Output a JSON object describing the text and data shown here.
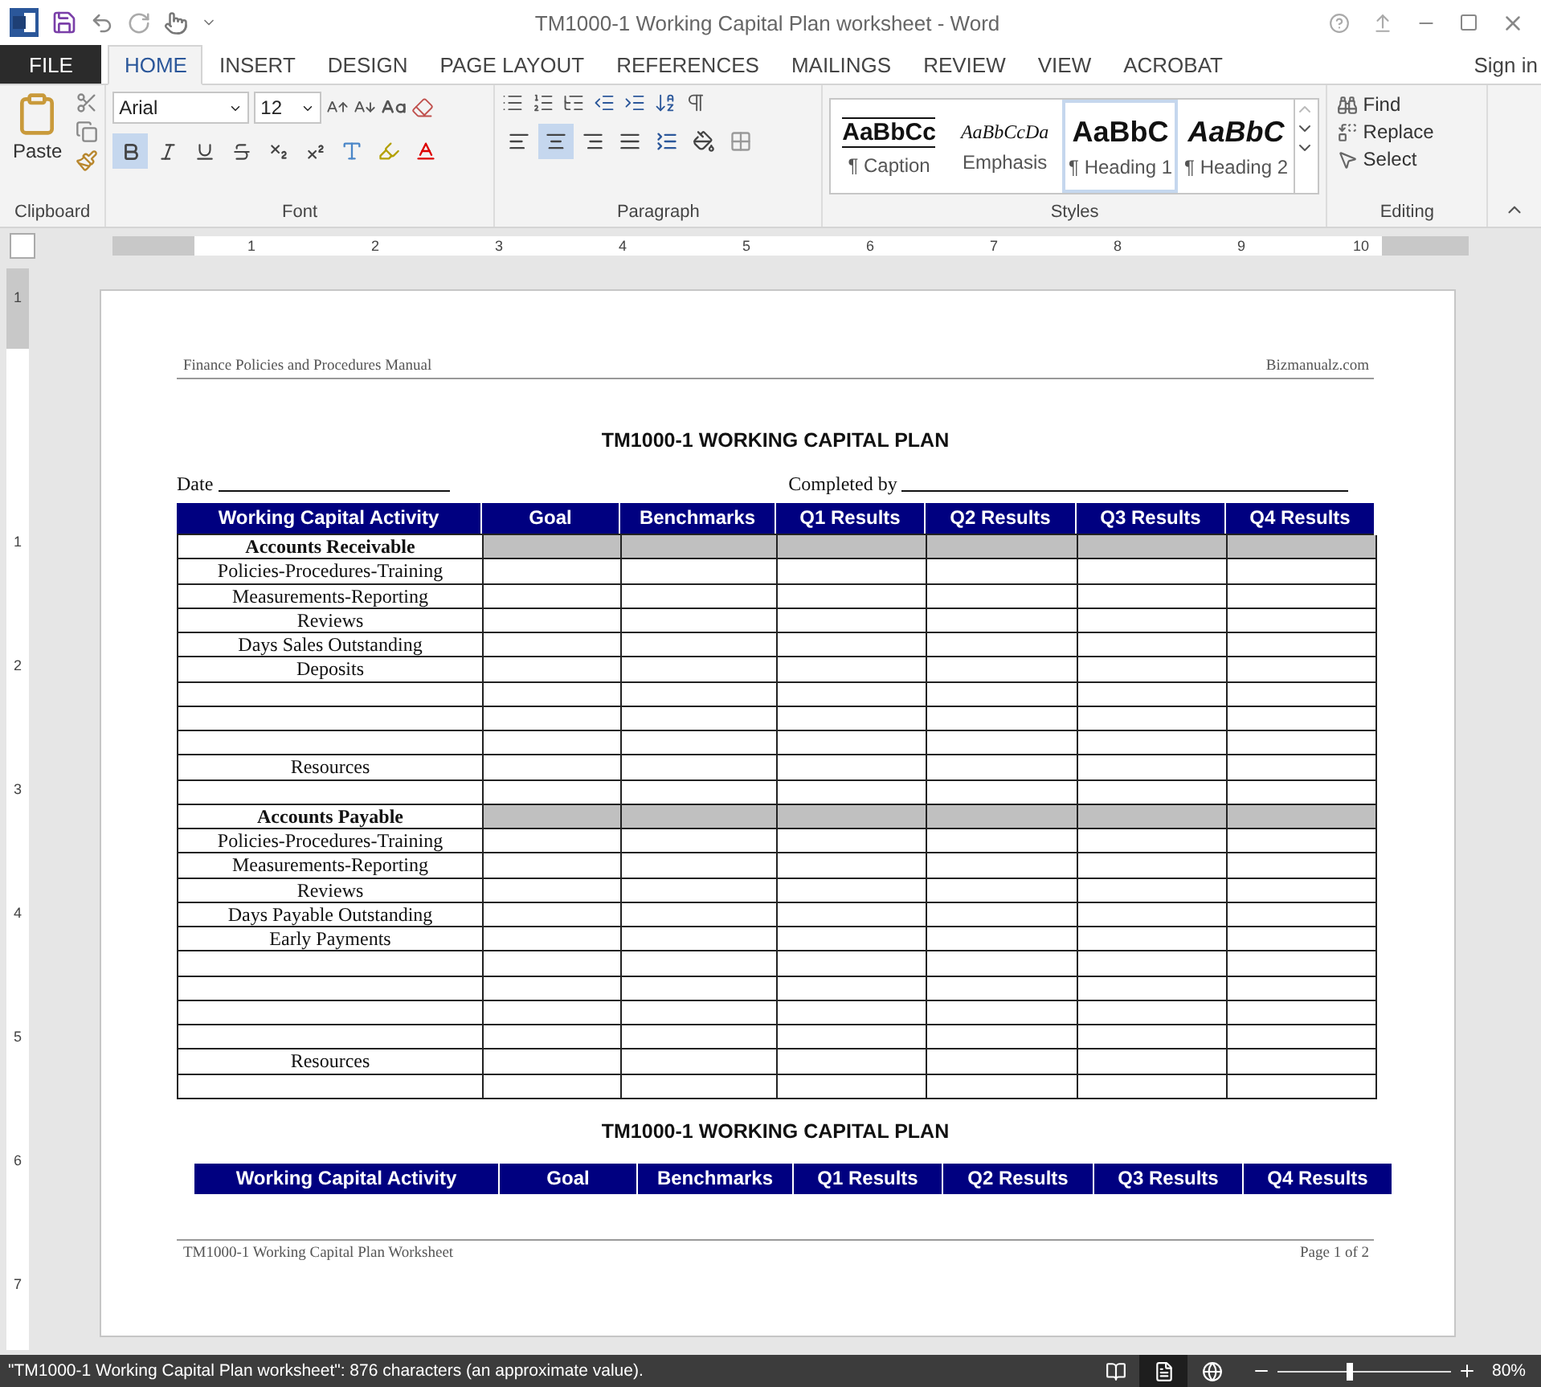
{
  "window": {
    "title": "TM1000-1 Working Capital Plan worksheet - Word"
  },
  "tabs": [
    {
      "label": "FILE",
      "kind": "file",
      "selected": false
    },
    {
      "label": "HOME",
      "kind": "tab",
      "selected": true
    },
    {
      "label": "INSERT",
      "kind": "tab",
      "selected": false
    },
    {
      "label": "DESIGN",
      "kind": "tab",
      "selected": false
    },
    {
      "label": "PAGE LAYOUT",
      "kind": "tab",
      "selected": false
    },
    {
      "label": "REFERENCES",
      "kind": "tab",
      "selected": false
    },
    {
      "label": "MAILINGS",
      "kind": "tab",
      "selected": false
    },
    {
      "label": "REVIEW",
      "kind": "tab",
      "selected": false
    },
    {
      "label": "VIEW",
      "kind": "tab",
      "selected": false
    },
    {
      "label": "ACROBAT",
      "kind": "tab",
      "selected": false
    }
  ],
  "account": {
    "label": "Sign in"
  },
  "ribbon": {
    "clipboard": {
      "label": "Clipboard",
      "paste": "Paste"
    },
    "font": {
      "label": "Font",
      "font_name": "Arial",
      "font_size": "12",
      "bold": true
    },
    "paragraph": {
      "label": "Paragraph",
      "alignments": [
        {
          "kind": "left",
          "selected": false
        },
        {
          "kind": "center",
          "selected": true
        },
        {
          "kind": "right",
          "selected": false
        },
        {
          "kind": "justify",
          "selected": false
        }
      ]
    },
    "styles": {
      "label": "Styles",
      "items": [
        {
          "preview": "AaBbCc",
          "name": "¶ Caption",
          "kind": "caption",
          "selected": false
        },
        {
          "preview": "AaBbCcDa",
          "name": "Emphasis",
          "kind": "emphasis",
          "selected": false
        },
        {
          "preview": "AaBbC",
          "name": "¶ Heading 1",
          "kind": "heading1",
          "selected": true
        },
        {
          "preview": "AaBbC",
          "name": "¶ Heading 2",
          "kind": "heading2",
          "selected": false
        }
      ]
    },
    "editing": {
      "label": "Editing",
      "items": [
        {
          "label": "Find",
          "kind": "find"
        },
        {
          "label": "Replace",
          "kind": "replace"
        },
        {
          "label": "Select",
          "kind": "select"
        }
      ]
    }
  },
  "ruler": {
    "marks": [
      "1",
      "2",
      "3",
      "4",
      "5",
      "6",
      "7",
      "8",
      "9",
      "10"
    ]
  },
  "vertical_ruler": {
    "marks": [
      "1",
      "1",
      "2",
      "3",
      "4",
      "5",
      "6",
      "7"
    ]
  },
  "document": {
    "header_left": "Finance Policies and Procedures Manual",
    "header_right": "Bizmanualz.com",
    "title": "TM1000-1 WORKING CAPITAL PLAN",
    "date_label": "Date",
    "completed_label": "Completed by",
    "columns": [
      "Working Capital Activity",
      "Goal",
      "Benchmarks",
      "Q1 Results",
      "Q2 Results",
      "Q3 Results",
      "Q4 Results"
    ],
    "rows": [
      {
        "kind": "section",
        "activity": "Accounts Receivable"
      },
      {
        "kind": "item",
        "activity": "Policies-Procedures-Training"
      },
      {
        "kind": "item",
        "activity": "Measurements-Reporting"
      },
      {
        "kind": "item",
        "activity": "Reviews"
      },
      {
        "kind": "item",
        "activity": "Days Sales Outstanding"
      },
      {
        "kind": "item",
        "activity": "Deposits"
      },
      {
        "kind": "blank"
      },
      {
        "kind": "blank"
      },
      {
        "kind": "blank"
      },
      {
        "kind": "item",
        "activity": "Resources"
      },
      {
        "kind": "blank"
      },
      {
        "kind": "section",
        "activity": "Accounts Payable"
      },
      {
        "kind": "item",
        "activity": "Policies-Procedures-Training"
      },
      {
        "kind": "item",
        "activity": "Measurements-Reporting"
      },
      {
        "kind": "item",
        "activity": "Reviews"
      },
      {
        "kind": "item",
        "activity": "Days Payable Outstanding"
      },
      {
        "kind": "item",
        "activity": "Early Payments"
      },
      {
        "kind": "blank"
      },
      {
        "kind": "blank"
      },
      {
        "kind": "blank"
      },
      {
        "kind": "blank"
      },
      {
        "kind": "item",
        "activity": "Resources"
      },
      {
        "kind": "blank"
      }
    ],
    "second_title": "TM1000-1 WORKING CAPITAL PLAN",
    "second_columns": [
      "Working Capital Activity",
      "Goal",
      "Benchmarks",
      "Q1 Results",
      "Q2 Results",
      "Q3 Results",
      "Q4 Results"
    ],
    "footer_left": "TM1000-1 Working Capital Plan Worksheet",
    "footer_right": "Page 1 of 2"
  },
  "status_bar": {
    "text": "\"TM1000-1 Working Capital Plan worksheet\": 876 characters (an approximate value).",
    "views": [
      {
        "kind": "read",
        "selected": false
      },
      {
        "kind": "print",
        "selected": true
      },
      {
        "kind": "web",
        "selected": false
      }
    ],
    "zoom_slider": {
      "level": 0.42
    },
    "zoom": "80%"
  }
}
